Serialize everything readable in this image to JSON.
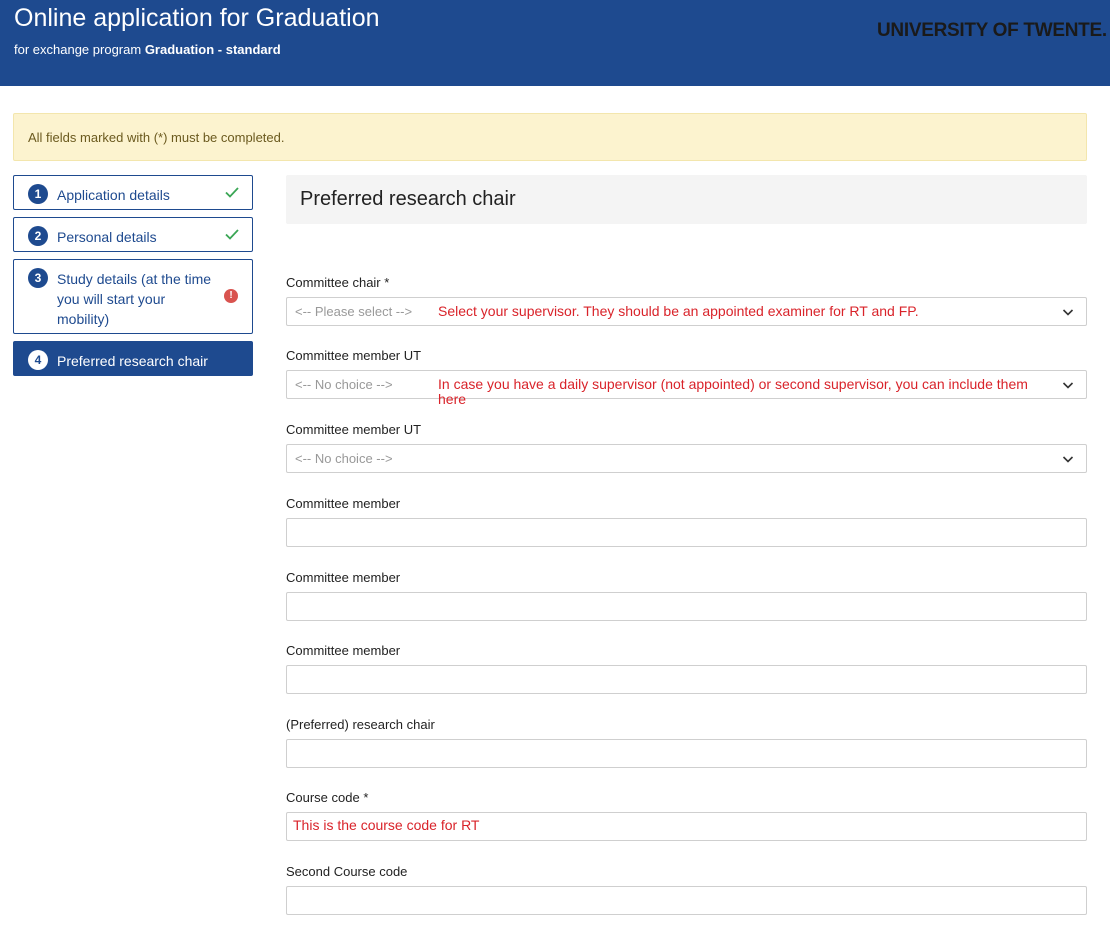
{
  "header": {
    "title": "Online application for Graduation",
    "subtitle_prefix": "for exchange program",
    "program_name": "Graduation",
    "program_sep": "-",
    "program_variant": "standard",
    "logo_text": "UNIVERSITY OF TWENTE."
  },
  "alert": {
    "text": "All fields marked with (*) must be completed."
  },
  "steps": [
    {
      "number": "1",
      "label": "Application details",
      "status": "complete"
    },
    {
      "number": "2",
      "label": "Personal details",
      "status": "complete"
    },
    {
      "number": "3",
      "label": "Study details (at the time you will start your mobility)",
      "status": "error",
      "error_glyph": "!"
    },
    {
      "number": "4",
      "label": "Preferred research chair",
      "status": "active"
    }
  ],
  "section": {
    "title": "Preferred research chair"
  },
  "fields": [
    {
      "label": "Committee chair *",
      "type": "select",
      "placeholder": "<-- Please select -->",
      "hint": "Select your supervisor. They should be an appointed examiner for RT and FP."
    },
    {
      "label": "Committee member UT",
      "type": "select",
      "placeholder": "<-- No choice -->",
      "hint": "In case you have a daily supervisor (not appointed) or second supervisor, you can include them here"
    },
    {
      "label": "Committee member UT",
      "type": "select",
      "placeholder": "<-- No choice -->"
    },
    {
      "label": "Committee member",
      "type": "text",
      "value": ""
    },
    {
      "label": "Committee member",
      "type": "text",
      "value": ""
    },
    {
      "label": "Committee member",
      "type": "text",
      "value": ""
    },
    {
      "label": "(Preferred) research chair",
      "type": "text",
      "value": ""
    },
    {
      "label": "Course code *",
      "type": "text",
      "value": "This is the course code for RT"
    },
    {
      "label": "Second Course code",
      "type": "text",
      "value": ""
    }
  ],
  "colors": {
    "brand_blue": "#1e4a8f",
    "alert_bg": "#fcf3cf",
    "check_green": "#3aa655",
    "error_red": "#d9534f",
    "annotation_red": "#d9232a"
  }
}
